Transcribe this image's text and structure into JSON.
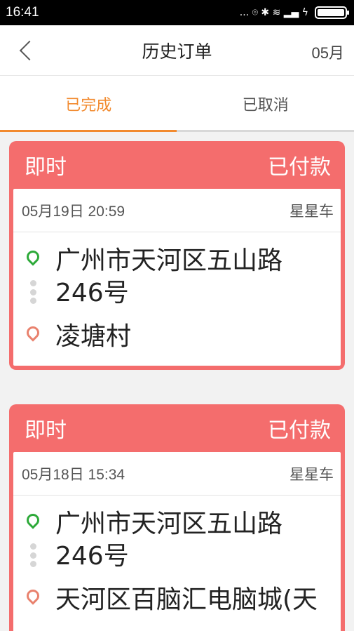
{
  "status_bar": {
    "time": "16:41",
    "indicators": "... ⌾ ✱ ≋ ▂▄ ϟ"
  },
  "header": {
    "title": "历史订单",
    "month": "05月"
  },
  "tabs": [
    {
      "label": "已完成",
      "active": true
    },
    {
      "label": "已取消",
      "active": false
    }
  ],
  "orders": [
    {
      "type": "即时",
      "status": "已付款",
      "datetime": "05月19日 20:59",
      "car": "星星车",
      "from": "广州市天河区五山路246号",
      "to": "凌塘村"
    },
    {
      "type": "即时",
      "status": "已付款",
      "datetime": "05月18日 15:34",
      "car": "星星车",
      "from": "广州市天河区五山路246号",
      "to": "天河区百脑汇电脑城(天"
    }
  ],
  "colors": {
    "accent": "#f28a2e",
    "card": "#f46d6d",
    "start_pin": "#2eaa3a",
    "end_pin": "#e9826e"
  }
}
